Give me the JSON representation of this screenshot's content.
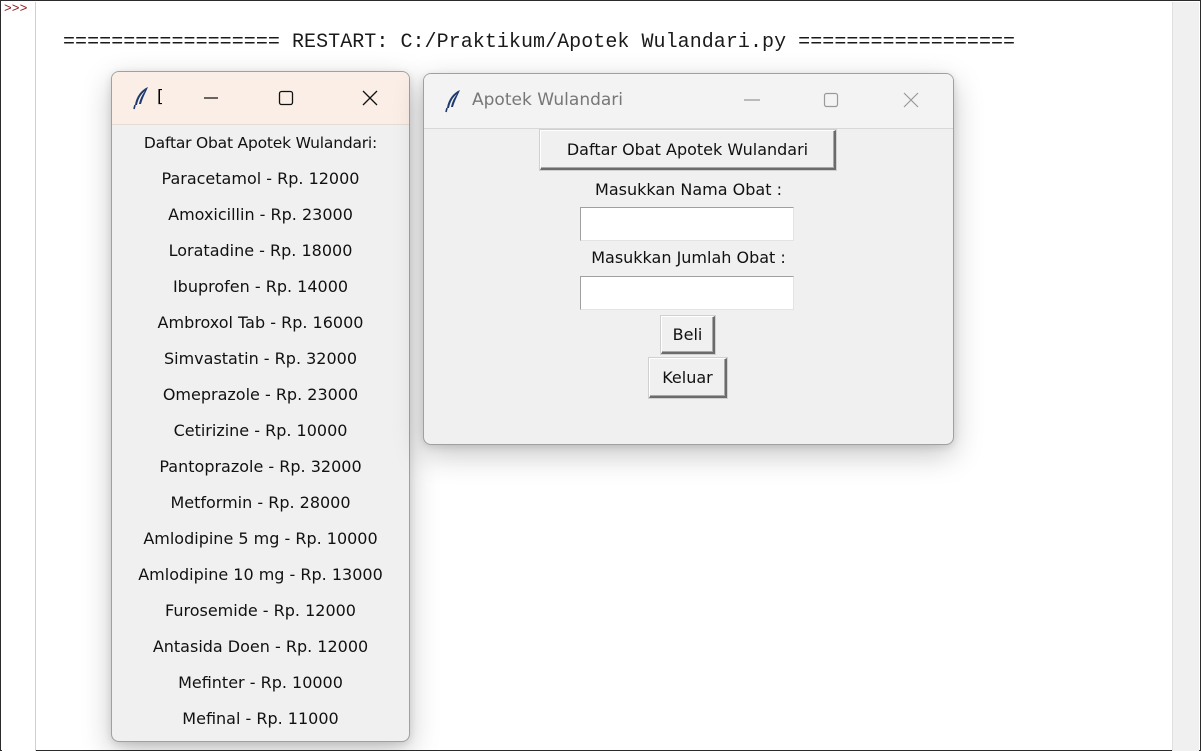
{
  "shell": {
    "prompt": ">>>",
    "restart_line": "================== RESTART: C:/Praktikum/Apotek Wulandari.py =================="
  },
  "list_window": {
    "title": "[",
    "items": [
      "Daftar Obat Apotek Wulandari:",
      "Paracetamol - Rp. 12000",
      "Amoxicillin - Rp. 23000",
      "Loratadine - Rp. 18000",
      "Ibuprofen - Rp. 14000",
      "Ambroxol Tab - Rp. 16000",
      "Simvastatin - Rp. 32000",
      "Omeprazole - Rp. 23000",
      "Cetirizine - Rp. 10000",
      "Pantoprazole - Rp. 32000",
      "Metformin - Rp. 28000",
      "Amlodipine 5 mg - Rp. 10000",
      "Amlodipine 10 mg - Rp. 13000",
      "Furosemide - Rp. 12000",
      "Antasida Doen - Rp. 12000",
      "Mefinter - Rp. 10000",
      "Mefinal - Rp. 11000"
    ]
  },
  "main_window": {
    "title": "Apotek Wulandari",
    "daftar_button": "Daftar Obat Apotek Wulandari",
    "nama_label": "Masukkan Nama Obat :",
    "nama_value": "",
    "jumlah_label": "Masukkan Jumlah Obat :",
    "jumlah_value": "",
    "beli_button": "Beli",
    "keluar_button": "Keluar"
  },
  "icons": {
    "app": "feather-icon",
    "minimize": "minimize-icon",
    "maximize": "maximize-icon",
    "close": "close-icon"
  },
  "colors": {
    "active_titlebar": "#faeee6",
    "inactive_titlebar": "#f3f3f3",
    "window_bg": "#f0f0f0"
  }
}
